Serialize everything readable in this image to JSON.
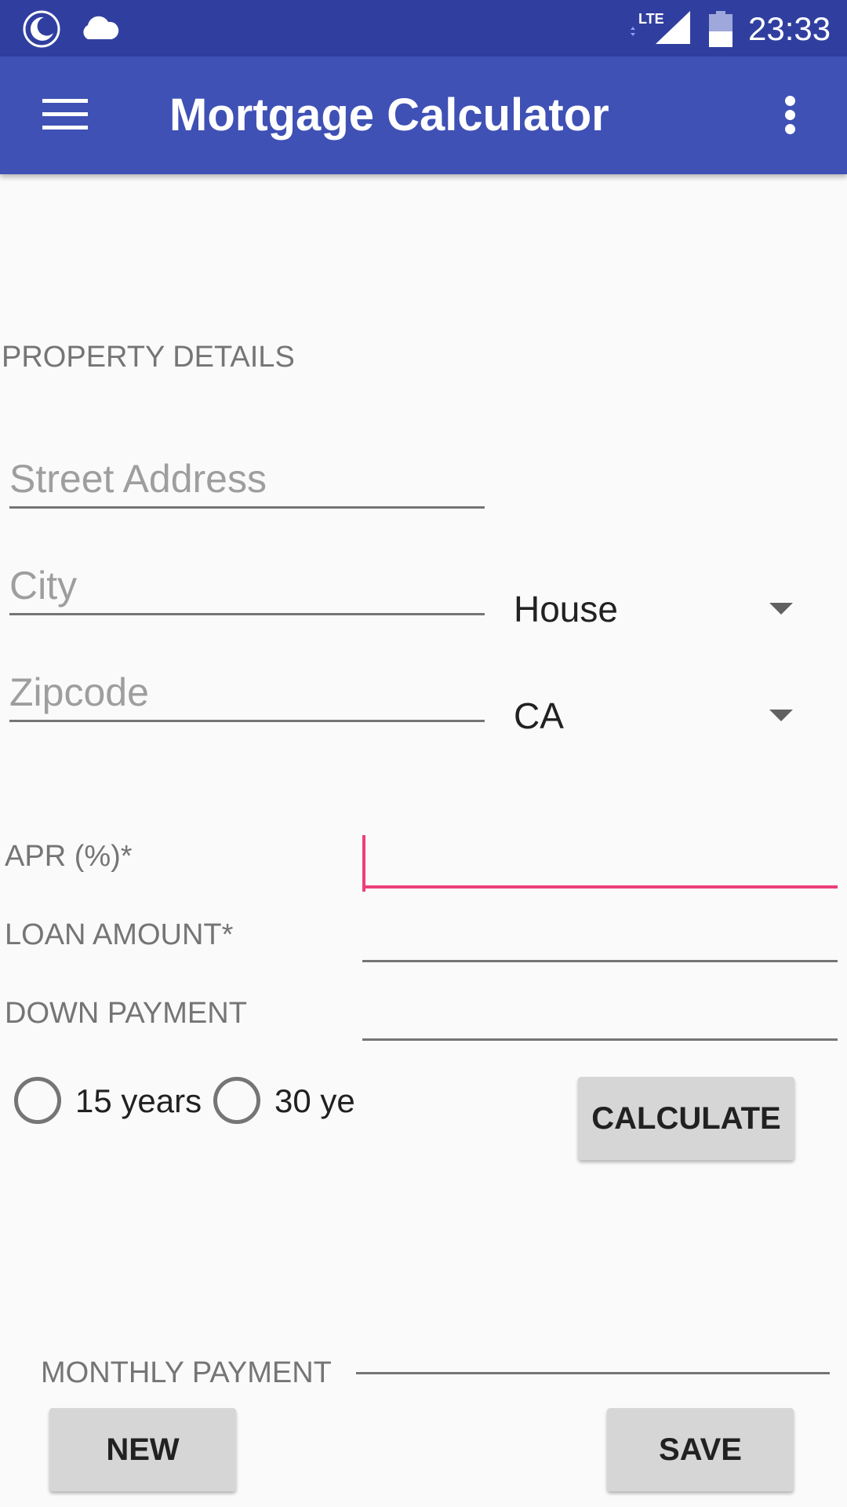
{
  "status_bar": {
    "time": "23:33",
    "network": "LTE",
    "icons": [
      "moon-icon",
      "cloud-icon",
      "lte-signal-icon",
      "battery-icon"
    ],
    "color": "#303f9f"
  },
  "app_bar": {
    "title": "Mortgage Calculator",
    "color": "#3f51b5",
    "icons": [
      "menu-icon",
      "more-vert-icon"
    ]
  },
  "property_details": {
    "section_title": "PROPERTY DETAILS",
    "street_placeholder": "Street Address",
    "city_placeholder": "City",
    "zipcode_placeholder": "Zipcode",
    "property_type": "House",
    "state": "CA"
  },
  "loan": {
    "apr_label": "APR (%)*",
    "loan_amount_label": "LOAN AMOUNT*",
    "down_payment_label": "DOWN PAYMENT",
    "apr_value": "",
    "loan_amount_value": "",
    "down_payment_value": "",
    "accent": "#ec407a"
  },
  "term": {
    "option_15": "15 years",
    "option_30": "30 ye"
  },
  "actions": {
    "calculate": "CALCULATE",
    "new": "NEW",
    "save": "SAVE"
  },
  "result": {
    "monthly_payment_label": "MONTHLY PAYMENT"
  }
}
